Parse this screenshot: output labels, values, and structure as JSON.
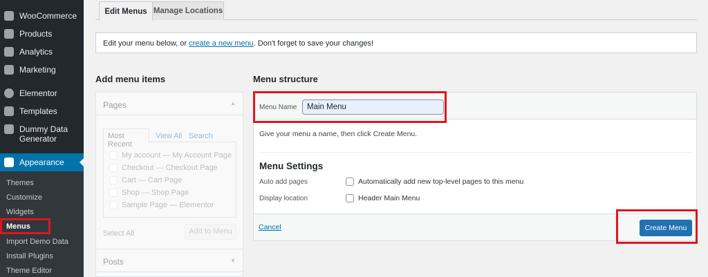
{
  "sidebar": {
    "items": [
      {
        "label": "WooCommerce",
        "icon": "woo-icon"
      },
      {
        "label": "Products",
        "icon": "box-icon"
      },
      {
        "label": "Analytics",
        "icon": "bar-chart-icon"
      },
      {
        "label": "Marketing",
        "icon": "megaphone-icon"
      },
      {
        "label": "Elementor",
        "icon": "elementor-icon"
      },
      {
        "label": "Templates",
        "icon": "folder-icon"
      },
      {
        "label": "Dummy Data",
        "label2": "Generator",
        "icon": "database-icon"
      },
      {
        "label": "Appearance",
        "icon": "paintbrush-icon"
      }
    ],
    "submenu": [
      "Themes",
      "Customize",
      "Widgets",
      "Menus",
      "Import Demo Data",
      "Install Plugins",
      "Theme Editor"
    ],
    "active_color": "#0073aa"
  },
  "tabs": [
    "Edit Menus",
    "Manage Locations"
  ],
  "notice": {
    "pre": "Edit your menu below, or ",
    "link": "create a new menu",
    "post": ". Don't forget to save your changes!"
  },
  "add_items": {
    "title": "Add menu items",
    "pages": "Pages",
    "inner_tabs": [
      "Most Recent",
      "View All",
      "Search"
    ],
    "pages_list": [
      "My account — My Account Page",
      "Checkout — Checkout Page",
      "Cart — Cart Page",
      "Shop — Shop Page",
      "Sample Page — Elementor"
    ],
    "select_all": "Select All",
    "add_button": "Add to Menu",
    "posts": "Posts"
  },
  "structure": {
    "title": "Menu structure",
    "name_label": "Menu Name",
    "name_value": "Main Menu",
    "description": "Give your menu a name, then click Create Menu.",
    "settings_title": "Menu Settings",
    "auto_add_label": "Auto add pages",
    "auto_add_option": "Automatically add new top-level pages to this menu",
    "location_label": "Display location",
    "location_option": "Header Main Menu",
    "cancel": "Cancel",
    "create": "Create Menu"
  }
}
